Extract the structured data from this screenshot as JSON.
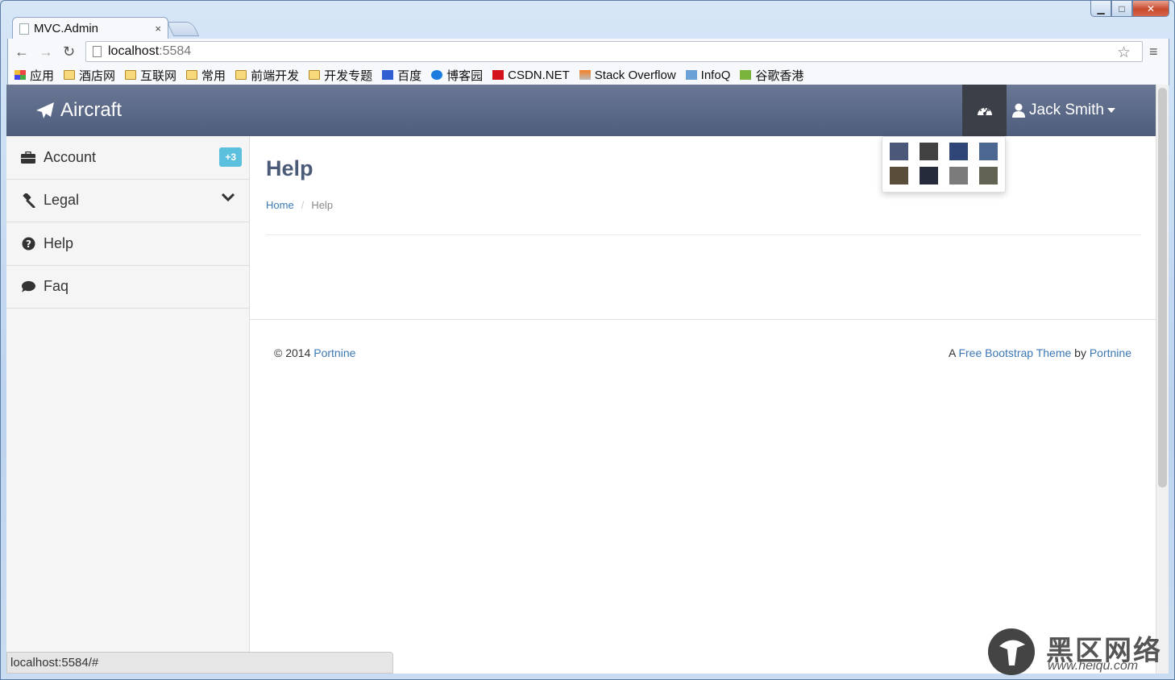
{
  "browser": {
    "tab_title": "MVC.Admin",
    "tab_close": "×",
    "url_host": "localhost",
    "url_port": ":5584",
    "bookmarks": [
      {
        "label": "应用",
        "icon": "apps-grid-icon"
      },
      {
        "label": "酒店网",
        "icon": "folder-icon"
      },
      {
        "label": "互联网",
        "icon": "folder-icon"
      },
      {
        "label": "常用",
        "icon": "folder-icon"
      },
      {
        "label": "前端开发",
        "icon": "folder-icon"
      },
      {
        "label": "开发专题",
        "icon": "folder-icon"
      },
      {
        "label": "百度",
        "icon": "baidu-icon"
      },
      {
        "label": "博客园",
        "icon": "cnblogs-icon"
      },
      {
        "label": "CSDN.NET",
        "icon": "csdn-icon"
      },
      {
        "label": "Stack Overflow",
        "icon": "stackoverflow-icon"
      },
      {
        "label": "InfoQ",
        "icon": "infoq-icon"
      },
      {
        "label": "谷歌香港",
        "icon": "google-hk-icon"
      }
    ],
    "status_url": "localhost:5584/#"
  },
  "app": {
    "brand": "Aircraft",
    "user_name": "Jack Smith",
    "theme_swatches": [
      "#4b587a",
      "#414141",
      "#2f4677",
      "#4d6793",
      "#594e3a",
      "#252b3a",
      "#7b7b7b",
      "#626352"
    ]
  },
  "sidebar": {
    "items": [
      {
        "label": "Account",
        "icon": "briefcase-icon",
        "badge": "+3"
      },
      {
        "label": "Legal",
        "icon": "gavel-icon"
      },
      {
        "label": "Help",
        "icon": "question-circle-icon"
      },
      {
        "label": "Faq",
        "icon": "comment-icon"
      }
    ]
  },
  "main": {
    "title": "Help",
    "breadcrumb": {
      "home": "Home",
      "separator": "/",
      "current": "Help"
    }
  },
  "footer": {
    "copyright": "© 2014",
    "left_link": "Portnine",
    "right_prefix": "A",
    "right_link1": "Free Bootstrap Theme",
    "right_mid": "by",
    "right_link2": "Portnine"
  },
  "watermark": {
    "text": "黑区网络",
    "url": "www.heiqu.com"
  }
}
